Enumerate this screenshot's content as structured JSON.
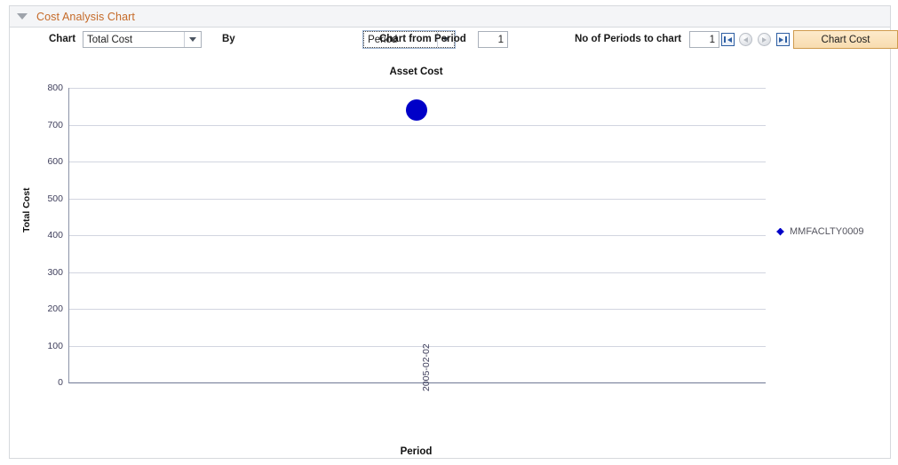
{
  "section": {
    "title": "Cost Analysis Chart",
    "collapse_icon": "triangle-down-icon",
    "title_color": "#c56a28"
  },
  "toolbar": {
    "chart_label": "Chart",
    "chart_select_value": "Total Cost",
    "by_label": "By",
    "by_select_value": "Period",
    "chart_from_period_label": "Chart from Period",
    "chart_from_period_value": "1",
    "no_of_periods_label": "No of Periods to chart",
    "no_of_periods_value": "1",
    "nav": {
      "first": "first-page-icon",
      "previous": "previous-page-icon",
      "next": "next-page-icon",
      "last": "last-page-icon"
    },
    "chart_cost_button": "Chart Cost",
    "button_color": "#f8dcaf"
  },
  "chart_data": {
    "type": "scatter",
    "title": "Asset Cost",
    "xlabel": "Period",
    "ylabel": "Total Cost",
    "grid": true,
    "legend_position": "right",
    "categories": [
      "2005-02-02"
    ],
    "x_tick_labels": [
      "2005-02-02"
    ],
    "ylim": [
      0,
      800
    ],
    "y_ticks": [
      0,
      100,
      200,
      300,
      400,
      500,
      600,
      700,
      800
    ],
    "y_tick_labels": [
      "0",
      "100",
      "200",
      "300",
      "400",
      "500",
      "600",
      "700",
      "800"
    ],
    "series": [
      {
        "name": "MMFACLTY0009",
        "color": "#0000c8",
        "marker": "circle",
        "values": [
          740
        ],
        "points": [
          {
            "x": "2005-02-02",
            "y": 740
          }
        ]
      }
    ],
    "legend": [
      "MMFACLTY0009"
    ]
  }
}
